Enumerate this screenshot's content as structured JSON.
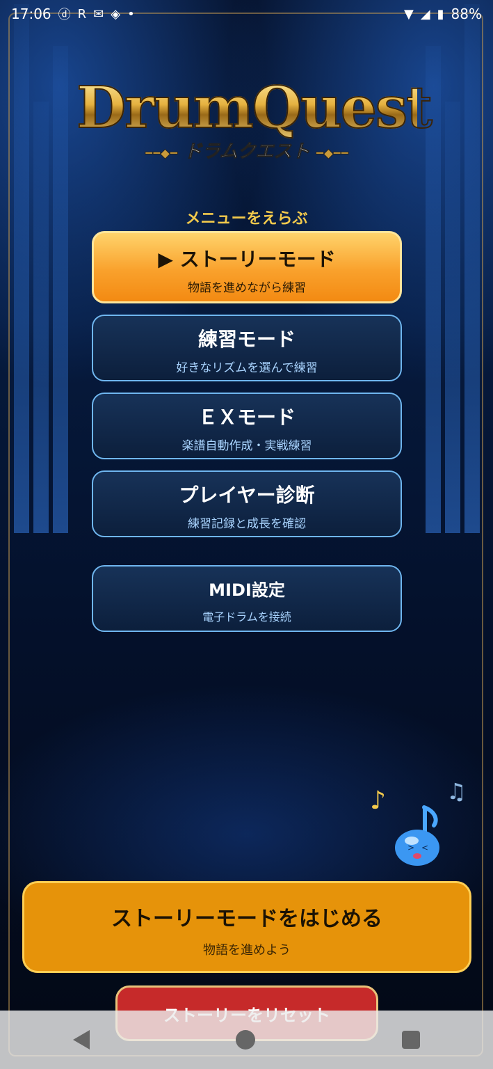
{
  "status_bar": {
    "time": "17:06",
    "left_icons": [
      "d-icon",
      "r-icon",
      "mail-icon",
      "diamond-icon",
      "dot-icon"
    ],
    "battery": "88%"
  },
  "logo": {
    "title": "DrumQuest",
    "subtitle": "ドラムクエスト"
  },
  "menu": {
    "heading": "メニューをえらぶ",
    "items": [
      {
        "title": "▶ ストーリーモード",
        "subtitle": "物語を進めながら練習"
      },
      {
        "title": "練習モード",
        "subtitle": "好きなリズムを選んで練習"
      },
      {
        "title": "ＥＸモード",
        "subtitle": "楽譜自動作成・実戦練習"
      },
      {
        "title": "プレイヤー診断",
        "subtitle": "練習記録と成長を確認"
      },
      {
        "title": "MIDI設定",
        "subtitle": "電子ドラムを接続"
      }
    ]
  },
  "cta": {
    "title": "ストーリーモードをはじめる",
    "subtitle": "物語を進めよう"
  },
  "reset": {
    "label": "ストーリーをリセット"
  },
  "colors": {
    "accent_gold": "#f2c94c",
    "primary_orange": "#f9a12c",
    "button_border_blue": "#6fb6ef",
    "reset_red": "#c62a2a"
  }
}
